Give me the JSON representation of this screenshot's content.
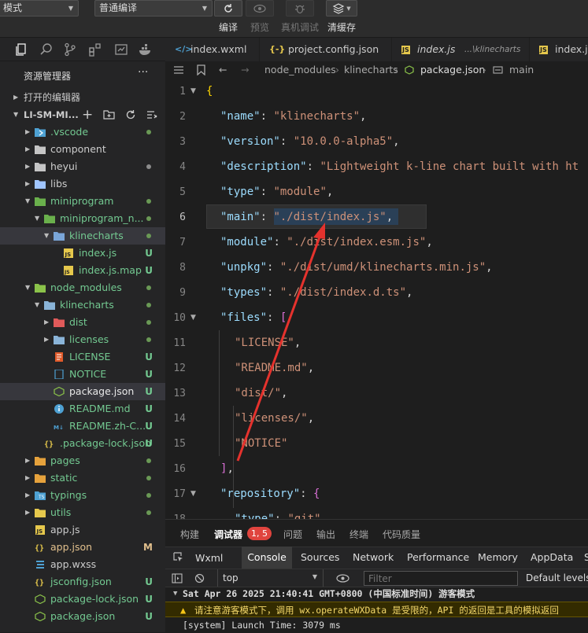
{
  "toolbar": {
    "mode_select": "模式",
    "compile_select": "普通编译",
    "labels": {
      "compile": "编译",
      "preview": "预览",
      "real_debug": "真机调试",
      "clear_cache": "清缓存"
    }
  },
  "explorer": {
    "title": "资源管理器",
    "more": "···",
    "open_editors": "打开的编辑器",
    "project": "LI-SM-MI...",
    "rows": [
      {
        "name": ".vscode",
        "status": "",
        "dot": "#6a9955"
      },
      {
        "name": "component",
        "status": "",
        "dot": ""
      },
      {
        "name": "heyui",
        "status": "",
        "dot": "#8c8c8c"
      },
      {
        "name": "libs",
        "status": "",
        "dot": ""
      },
      {
        "name": "miniprogram",
        "status": "",
        "dot": "#6a9955"
      },
      {
        "name": "miniprogram_n...",
        "status": "",
        "dot": "#6a9955"
      },
      {
        "name": "klinecharts",
        "status": "",
        "dot": "#6a9955"
      },
      {
        "name": "index.js",
        "status": "U",
        "dot": ""
      },
      {
        "name": "index.js.map",
        "status": "U",
        "dot": ""
      },
      {
        "name": "node_modules",
        "status": "",
        "dot": "#6a9955"
      },
      {
        "name": "klinecharts",
        "status": "",
        "dot": "#6a9955"
      },
      {
        "name": "dist",
        "status": "",
        "dot": "#6a9955"
      },
      {
        "name": "licenses",
        "status": "",
        "dot": "#6a9955"
      },
      {
        "name": "LICENSE",
        "status": "U",
        "dot": ""
      },
      {
        "name": "NOTICE",
        "status": "U",
        "dot": ""
      },
      {
        "name": "package.json",
        "status": "U",
        "dot": ""
      },
      {
        "name": "README.md",
        "status": "U",
        "dot": ""
      },
      {
        "name": "README.zh-C...",
        "status": "U",
        "dot": ""
      },
      {
        "name": ".package-lock.json",
        "status": "U",
        "dot": ""
      },
      {
        "name": "pages",
        "status": "",
        "dot": "#6a9955"
      },
      {
        "name": "static",
        "status": "",
        "dot": "#6a9955"
      },
      {
        "name": "typings",
        "status": "",
        "dot": "#6a9955"
      },
      {
        "name": "utils",
        "status": "",
        "dot": "#6a9955"
      },
      {
        "name": "app.js",
        "status": "",
        "dot": ""
      },
      {
        "name": "app.json",
        "status": "M",
        "dot": ""
      },
      {
        "name": "app.wxss",
        "status": "",
        "dot": ""
      },
      {
        "name": "jsconfig.json",
        "status": "U",
        "dot": ""
      },
      {
        "name": "package-lock.json",
        "status": "U",
        "dot": ""
      },
      {
        "name": "package.json",
        "status": "U",
        "dot": ""
      }
    ]
  },
  "tabs": [
    "index.wxml",
    "project.config.json",
    "index.js",
    "...\\klinecharts",
    "index.js"
  ],
  "breadcrumb": [
    "node_modules",
    "klinecharts",
    "package.json",
    "main"
  ],
  "code": {
    "line_numbers": [
      "1",
      "2",
      "3",
      "4",
      "5",
      "6",
      "7",
      "8",
      "9",
      "10",
      "11",
      "12",
      "13",
      "14",
      "15",
      "16",
      "17",
      "18"
    ],
    "lines": [
      [
        "{"
      ],
      [
        "\"name\"",
        ": ",
        "\"klinecharts\"",
        ","
      ],
      [
        "\"version\"",
        ": ",
        "\"10.0.0-alpha5\"",
        ","
      ],
      [
        "\"description\"",
        ": ",
        "\"Lightweight k-line chart built with ht",
        ""
      ],
      [
        "\"type\"",
        ": ",
        "\"module\"",
        ","
      ],
      [
        "\"main\"",
        ": ",
        "\"./dist/index.js\"",
        ","
      ],
      [
        "\"module\"",
        ": ",
        "\"./dist/index.esm.js\"",
        ","
      ],
      [
        "\"unpkg\"",
        ": ",
        "\"./dist/umd/klinecharts.min.js\"",
        ","
      ],
      [
        "\"types\"",
        ": ",
        "\"./dist/index.d.ts\"",
        ","
      ],
      [
        "\"files\"",
        ": ",
        "[",
        ""
      ],
      [
        "\"LICENSE\"",
        ","
      ],
      [
        "\"README.md\"",
        ","
      ],
      [
        "\"dist/\"",
        ","
      ],
      [
        "\"licenses/\"",
        ","
      ],
      [
        "\"NOTICE\""
      ],
      [
        "]",
        ","
      ],
      [
        "\"repository\"",
        ": ",
        "{",
        ""
      ],
      [
        "\"type\"",
        ": ",
        "\"git\"",
        ""
      ]
    ]
  },
  "panel": {
    "tabs": [
      "构建",
      "调试器",
      "问题",
      "输出",
      "终端",
      "代码质量"
    ],
    "badge": "1, 5",
    "devtools_tabs": [
      "Wxml",
      "Console",
      "Sources",
      "Network",
      "Performance",
      "Memory",
      "AppData",
      "S"
    ],
    "context": "top",
    "filter_placeholder": "Filter",
    "levels": "Default levels",
    "console": [
      "Sat Apr 26 2025 21:40:41 GMT+0800 (中国标准时间) 游客模式",
      "请注意游客模式下，调用 wx.operateWXData 是受限的，API 的返回是工具的模拟返回",
      "[system] Launch Time: 3079 ms"
    ]
  }
}
